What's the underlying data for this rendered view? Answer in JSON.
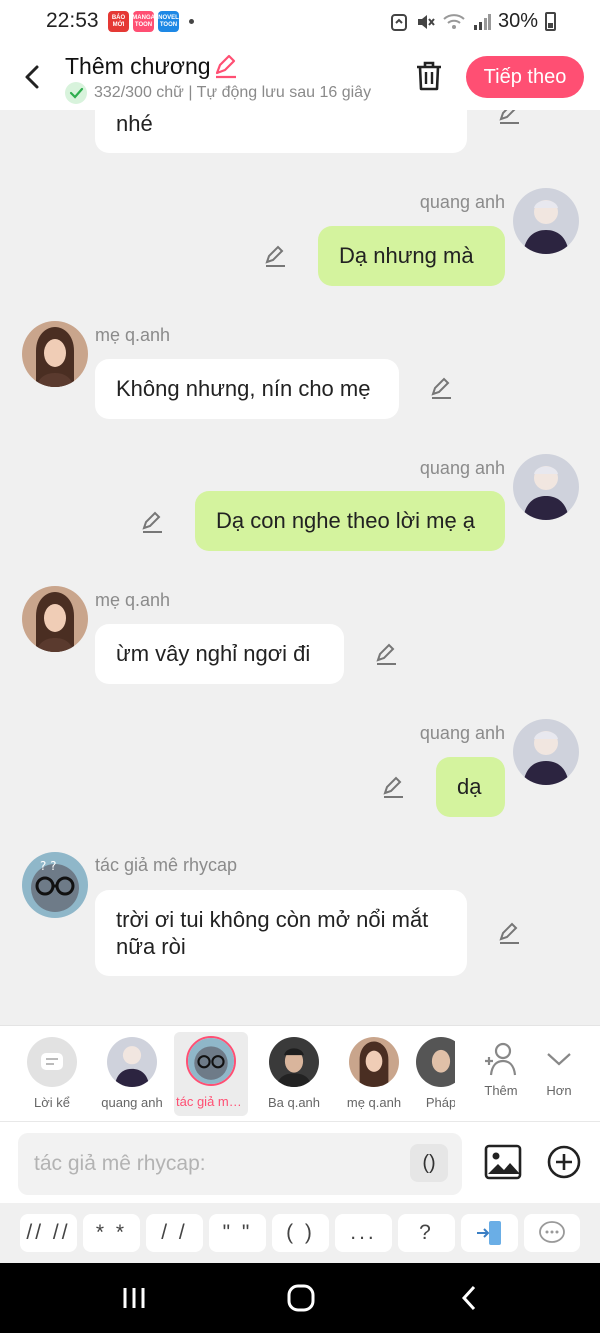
{
  "status_bar": {
    "time": "22:53",
    "apps": [
      {
        "name": "BÁO MỚI",
        "color": "#e53935"
      },
      {
        "name": "MANGA TOON",
        "color": "#ff4f73"
      },
      {
        "name": "NOVEL TOON",
        "color": "#1e88e5"
      }
    ],
    "battery": "30%"
  },
  "header": {
    "title": "Thêm chương",
    "subtitle": "332/300 chữ | Tự động lưu sau 16 giây",
    "next_label": "Tiếp theo"
  },
  "messages": [
    {
      "side": "left",
      "text": "nhé"
    },
    {
      "side": "right",
      "speaker": "quang anh",
      "text": "Dạ nhưng mà"
    },
    {
      "side": "left",
      "speaker": "mẹ q.anh",
      "text": "Không nhưng, nín cho mẹ"
    },
    {
      "side": "right",
      "speaker": "quang anh",
      "text": "Dạ con nghe theo lời mẹ ạ"
    },
    {
      "side": "left",
      "speaker": "mẹ q.anh",
      "text": "ừm vây nghỉ ngơi đi"
    },
    {
      "side": "right",
      "speaker": "quang anh",
      "text": "dạ"
    },
    {
      "side": "left",
      "speaker": "tác giả mê rhycap",
      "text": "trời ơi tui không còn mở nổi mắt nữa ròi"
    }
  ],
  "characters": [
    {
      "label": "Lời kể",
      "icon": "narration-icon"
    },
    {
      "label": "quang anh",
      "icon": "avatar"
    },
    {
      "label": "tác giả mê rhycap",
      "icon": "avatar",
      "selected": true
    },
    {
      "label": "Ba q.anh",
      "icon": "avatar"
    },
    {
      "label": "mẹ q.anh",
      "icon": "avatar"
    },
    {
      "label": "Pháp",
      "icon": "avatar"
    },
    {
      "label": "Thêm",
      "icon": "add-person-icon"
    },
    {
      "label": "Hơn",
      "icon": "chevron-down-icon"
    }
  ],
  "input": {
    "placeholder": "tác giả mê rhycap:",
    "paren_label": "()"
  },
  "symbols": [
    "// //",
    "* *",
    "/ /",
    "\" \"",
    "( )",
    "...",
    "?"
  ],
  "colors": {
    "accent": "#ff4f73",
    "bubble_right": "#d4f39e",
    "bubble_left": "#ffffff"
  }
}
